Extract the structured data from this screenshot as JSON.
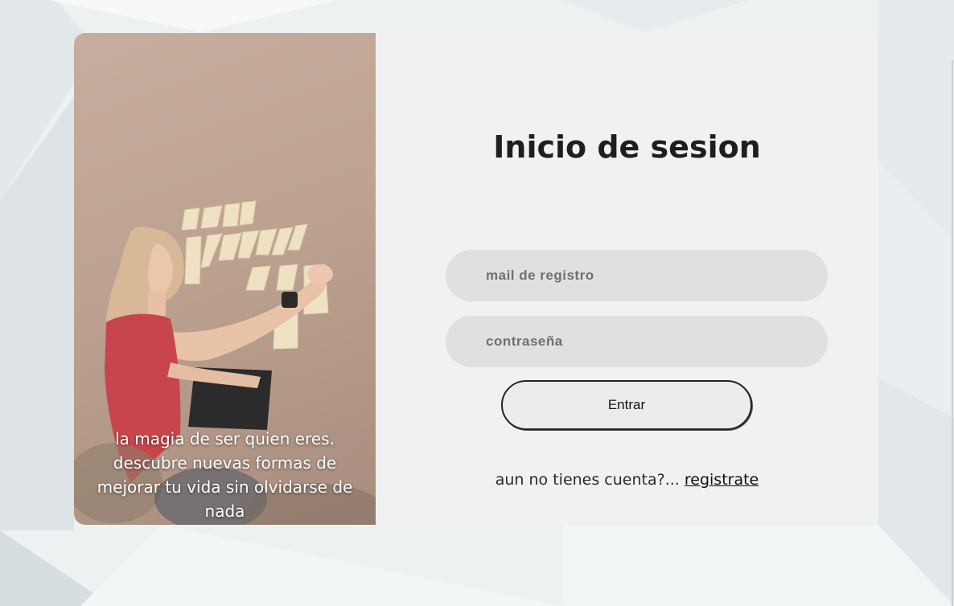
{
  "hero": {
    "caption_lines": [
      "la magia de ser quien eres.",
      "descubre nuevas formas de",
      "mejorar tu vida sin olvidarse de",
      "nada"
    ]
  },
  "login": {
    "title": "Inicio de sesion",
    "email_placeholder": "mail de registro",
    "password_placeholder": "contraseña",
    "submit_label": "Entrar",
    "signup_prompt": "aun no tienes cuenta?... ",
    "signup_link": "registrate"
  },
  "colors": {
    "page_background": "#eef1f2",
    "card_background": "#f1f1f1",
    "input_background": "#e0e0e0",
    "title_text": "#1e1e1e"
  }
}
